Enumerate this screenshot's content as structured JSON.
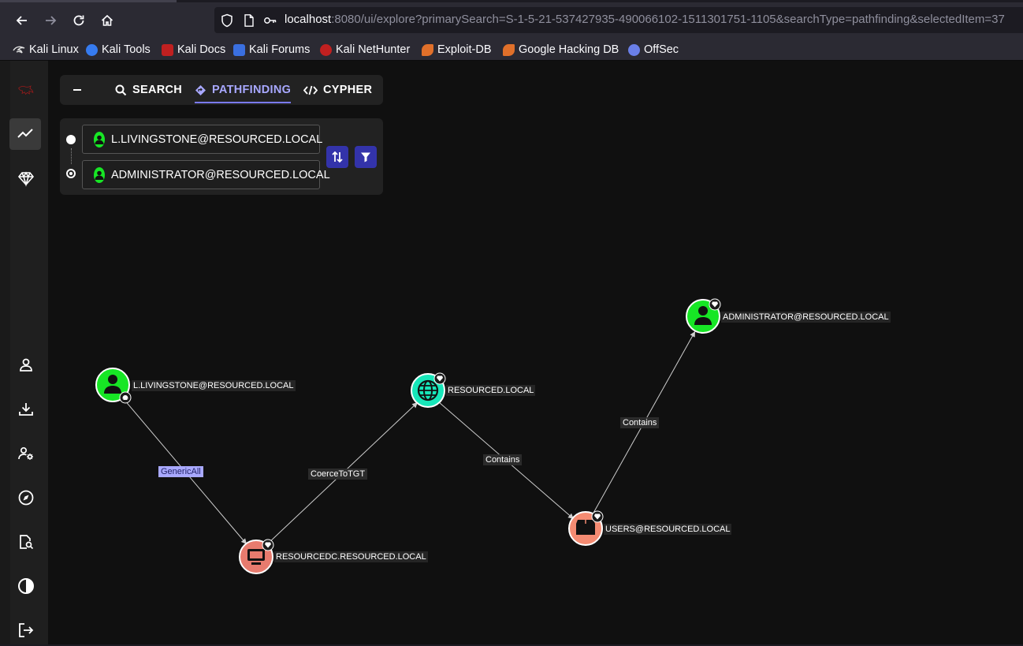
{
  "browser": {
    "url_host": "localhost",
    "url_rest": ":8080/ui/explore?primarySearch=S-1-5-21-537427935-490066102-1511301751-1105&searchType=pathfinding&selectedItem=37",
    "bookmarks": [
      {
        "label": "Kali Linux",
        "color": "#367bf0"
      },
      {
        "label": "Kali Tools",
        "color": "#d03fd0"
      },
      {
        "label": "Kali Docs",
        "color": "#c02020"
      },
      {
        "label": "Kali Forums",
        "color": "#3a6fe0"
      },
      {
        "label": "Kali NetHunter",
        "color": "#c02020"
      },
      {
        "label": "Exploit-DB",
        "color": "#e0702a"
      },
      {
        "label": "Google Hacking DB",
        "color": "#e0702a"
      },
      {
        "label": "OffSec",
        "color": "#6a7fe8"
      }
    ]
  },
  "tabs": {
    "search": "SEARCH",
    "pathfinding": "PATHFINDING",
    "cypher": "CYPHER"
  },
  "pathfinding": {
    "start": "L.LIVINGSTONE@RESOURCED.LOCAL",
    "end": "ADMINISTRATOR@RESOURCED.LOCAL"
  },
  "graph": {
    "nodes": [
      {
        "id": "n1",
        "label": "L.LIVINGSTONE@RESOURCED.LOCAL",
        "kind": "user",
        "color": "#17e625"
      },
      {
        "id": "n2",
        "label": "RESOURCEDC.RESOURCED.LOCAL",
        "kind": "computer",
        "color": "#e77b6e"
      },
      {
        "id": "n3",
        "label": "RESOURCED.LOCAL",
        "kind": "domain",
        "color": "#17e6b9"
      },
      {
        "id": "n4",
        "label": "USERS@RESOURCED.LOCAL",
        "kind": "container",
        "color": "#f48b72"
      },
      {
        "id": "n5",
        "label": "ADMINISTRATOR@RESOURCED.LOCAL",
        "kind": "user",
        "color": "#17e625"
      }
    ],
    "edges": [
      {
        "from": "n1",
        "to": "n2",
        "label": "GenericAll",
        "highlighted": true
      },
      {
        "from": "n2",
        "to": "n3",
        "label": "CoerceToTGT",
        "highlighted": false
      },
      {
        "from": "n3",
        "to": "n4",
        "label": "Contains",
        "highlighted": false
      },
      {
        "from": "n4",
        "to": "n5",
        "label": "Contains",
        "highlighted": false
      }
    ]
  }
}
